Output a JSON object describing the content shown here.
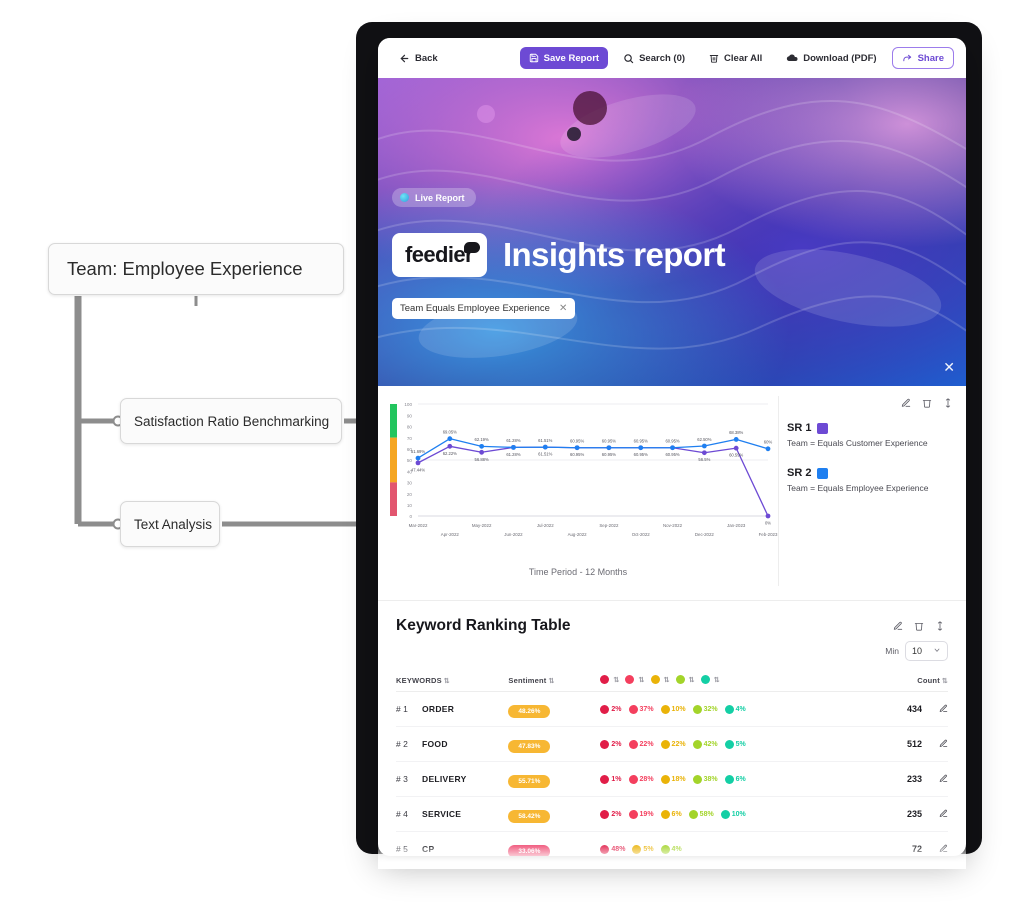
{
  "diagram": {
    "root": "Team: Employee Experience",
    "children": [
      "Satisfaction Ratio Benchmarking",
      "Text Analysis"
    ]
  },
  "toolbar": {
    "back": "Back",
    "save_report": "Save Report",
    "search": "Search (0)",
    "clear_all": "Clear All",
    "download": "Download (PDF)",
    "share": "Share",
    "accent": "#6d4ad4"
  },
  "hero": {
    "live_badge": "Live Report",
    "logo": "feedier",
    "title": "Insights report",
    "filter_chip": "Team Equals Employee Experience",
    "filter_chip_close": "✕",
    "close": "✕"
  },
  "chart_card": {
    "tools": [
      "edit-icon",
      "trash-icon",
      "move-icon"
    ],
    "legend": [
      {
        "name": "SR 1",
        "color": "#6d4ad4",
        "description": "Team = Equals Customer Experience"
      },
      {
        "name": "SR 2",
        "color": "#1f7ff0",
        "description": "Team = Equals Employee Experience"
      }
    ]
  },
  "chart_data": {
    "type": "line",
    "title": "",
    "xlabel": "Time Period - 12 Months",
    "ylabel": "",
    "ylim": [
      0,
      100
    ],
    "yticks": [
      0,
      10,
      20,
      30,
      40,
      50,
      60,
      70,
      80,
      90,
      100
    ],
    "grid": true,
    "legend_position": "right",
    "categories": [
      "Mar-2022",
      "Apr-2022",
      "May-2022",
      "Jun-2022",
      "Jul-2022",
      "Aug-2022",
      "Sep-2022",
      "Oct-2022",
      "Nov-2022",
      "Dec-2022",
      "Jan-2023",
      "Feb-2023"
    ],
    "series": [
      {
        "name": "SR 1",
        "color": "#6d4ad4",
        "values": [
          47.44,
          62.22,
          56.88,
          61.28,
          61.51,
          60.95,
          60.95,
          60.95,
          60.95,
          56.5,
          60.59,
          0
        ],
        "labels": [
          "47.44%",
          "62.22%",
          "56.88%",
          "61.28%",
          "61.51%",
          "60.95%",
          "60.95%",
          "60.95%",
          "60.95%",
          "56.5%",
          "60.59%",
          "0%"
        ]
      },
      {
        "name": "SR 2",
        "color": "#1f7ff0",
        "values": [
          51.69,
          69.05,
          62.19,
          61.28,
          61.51,
          60.95,
          60.95,
          60.95,
          60.95,
          62.5,
          68.38,
          60
        ],
        "labels": [
          "51.69%",
          "69.05%",
          "62.19%",
          "61.28%",
          "61.51%",
          "60.95%",
          "60.95%",
          "60.95%",
          "60.95%",
          "62.50%",
          "68.38%",
          "60%"
        ]
      }
    ],
    "gauge_bands": [
      {
        "from": 70,
        "to": 100,
        "color": "#22c55e"
      },
      {
        "from": 30,
        "to": 70,
        "color": "#f5a623"
      },
      {
        "from": 0,
        "to": 30,
        "color": "#e2566f"
      }
    ]
  },
  "table_card": {
    "title": "Keyword Ranking Table",
    "tools": [
      "edit-icon",
      "trash-icon",
      "move-icon"
    ],
    "min_label": "Min",
    "min_value": "10",
    "columns": {
      "keywords": "KEYWORDS",
      "sentiment": "Sentiment",
      "count": "Count"
    },
    "emoji_columns": [
      {
        "name": "very-negative",
        "color": "#e11d48"
      },
      {
        "name": "negative",
        "color": "#f43f5e"
      },
      {
        "name": "neutral",
        "color": "#eab308"
      },
      {
        "name": "positive",
        "color": "#a3d42a"
      },
      {
        "name": "very-positive",
        "color": "#14cfa5"
      }
    ],
    "rows": [
      {
        "rank": "# 1",
        "keyword": "ORDER",
        "sentiment": "48.26%",
        "sentiment_color": "#f7b733",
        "breakdown": [
          {
            "color": "#e11d48",
            "value": "2%"
          },
          {
            "color": "#f43f5e",
            "value": "37%"
          },
          {
            "color": "#eab308",
            "value": "10%"
          },
          {
            "color": "#a3d42a",
            "value": "32%"
          },
          {
            "color": "#14cfa5",
            "value": "4%"
          }
        ],
        "count": "434"
      },
      {
        "rank": "# 2",
        "keyword": "FOOD",
        "sentiment": "47.83%",
        "sentiment_color": "#f7b733",
        "breakdown": [
          {
            "color": "#e11d48",
            "value": "2%"
          },
          {
            "color": "#f43f5e",
            "value": "22%"
          },
          {
            "color": "#eab308",
            "value": "22%"
          },
          {
            "color": "#a3d42a",
            "value": "42%"
          },
          {
            "color": "#14cfa5",
            "value": "5%"
          }
        ],
        "count": "512"
      },
      {
        "rank": "# 3",
        "keyword": "DELIVERY",
        "sentiment": "55.71%",
        "sentiment_color": "#f7b733",
        "breakdown": [
          {
            "color": "#e11d48",
            "value": "1%"
          },
          {
            "color": "#f43f5e",
            "value": "28%"
          },
          {
            "color": "#eab308",
            "value": "18%"
          },
          {
            "color": "#a3d42a",
            "value": "38%"
          },
          {
            "color": "#14cfa5",
            "value": "6%"
          }
        ],
        "count": "233"
      },
      {
        "rank": "# 4",
        "keyword": "SERVICE",
        "sentiment": "58.42%",
        "sentiment_color": "#f7b733",
        "breakdown": [
          {
            "color": "#e11d48",
            "value": "2%"
          },
          {
            "color": "#f43f5e",
            "value": "19%"
          },
          {
            "color": "#eab308",
            "value": "6%"
          },
          {
            "color": "#a3d42a",
            "value": "58%"
          },
          {
            "color": "#14cfa5",
            "value": "10%"
          }
        ],
        "count": "235"
      },
      {
        "rank": "# 5",
        "keyword": "CP",
        "sentiment": "33.06%",
        "sentiment_color": "#ef4b72",
        "breakdown": [
          {
            "color": "#e11d48",
            "value": "48%"
          },
          {
            "color": "#eab308",
            "value": "5%"
          },
          {
            "color": "#a3d42a",
            "value": "4%"
          }
        ],
        "count": "72"
      }
    ]
  }
}
